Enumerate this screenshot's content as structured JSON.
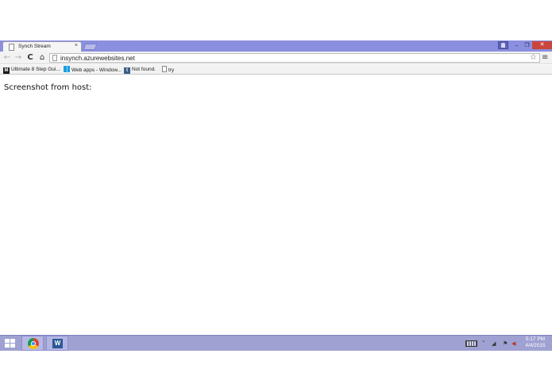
{
  "browser": {
    "tab": {
      "title": "Synch Stream",
      "close_glyph": "×",
      "icon": "page-icon"
    },
    "window_controls": {
      "minimize": "–",
      "maximize": "❐",
      "close": "✕"
    },
    "toolbar": {
      "back_glyph": "←",
      "forward_glyph": "→",
      "reload_glyph": "C",
      "home_glyph": "⌂",
      "url": "insynch.azurewebsites.net",
      "star_glyph": "☆",
      "menu_glyph": "≡"
    },
    "bookmarks": [
      {
        "label": "Ultimate 8 Step Gui...",
        "icon_glyph": "M"
      },
      {
        "label": "Web apps - Window...",
        "icon_glyph": ""
      },
      {
        "label": "Not found.",
        "icon_glyph": "t"
      },
      {
        "label": "try",
        "icon_glyph": ""
      }
    ]
  },
  "page": {
    "heading": "Screenshot from host:"
  },
  "taskbar": {
    "apps": [
      "start",
      "chrome",
      "word"
    ],
    "word_icon_glyph": "W",
    "tray": {
      "arrow_glyph": "˄",
      "signal_glyph": "◢",
      "flag_glyph": "⚑",
      "volume_glyph": "◀",
      "time": "5:17 PM",
      "date": "4/4/2015"
    }
  },
  "colors": {
    "titlebar": "#8b8fe0",
    "taskbar": "#9ea1d1",
    "close_button": "#c9463d"
  }
}
